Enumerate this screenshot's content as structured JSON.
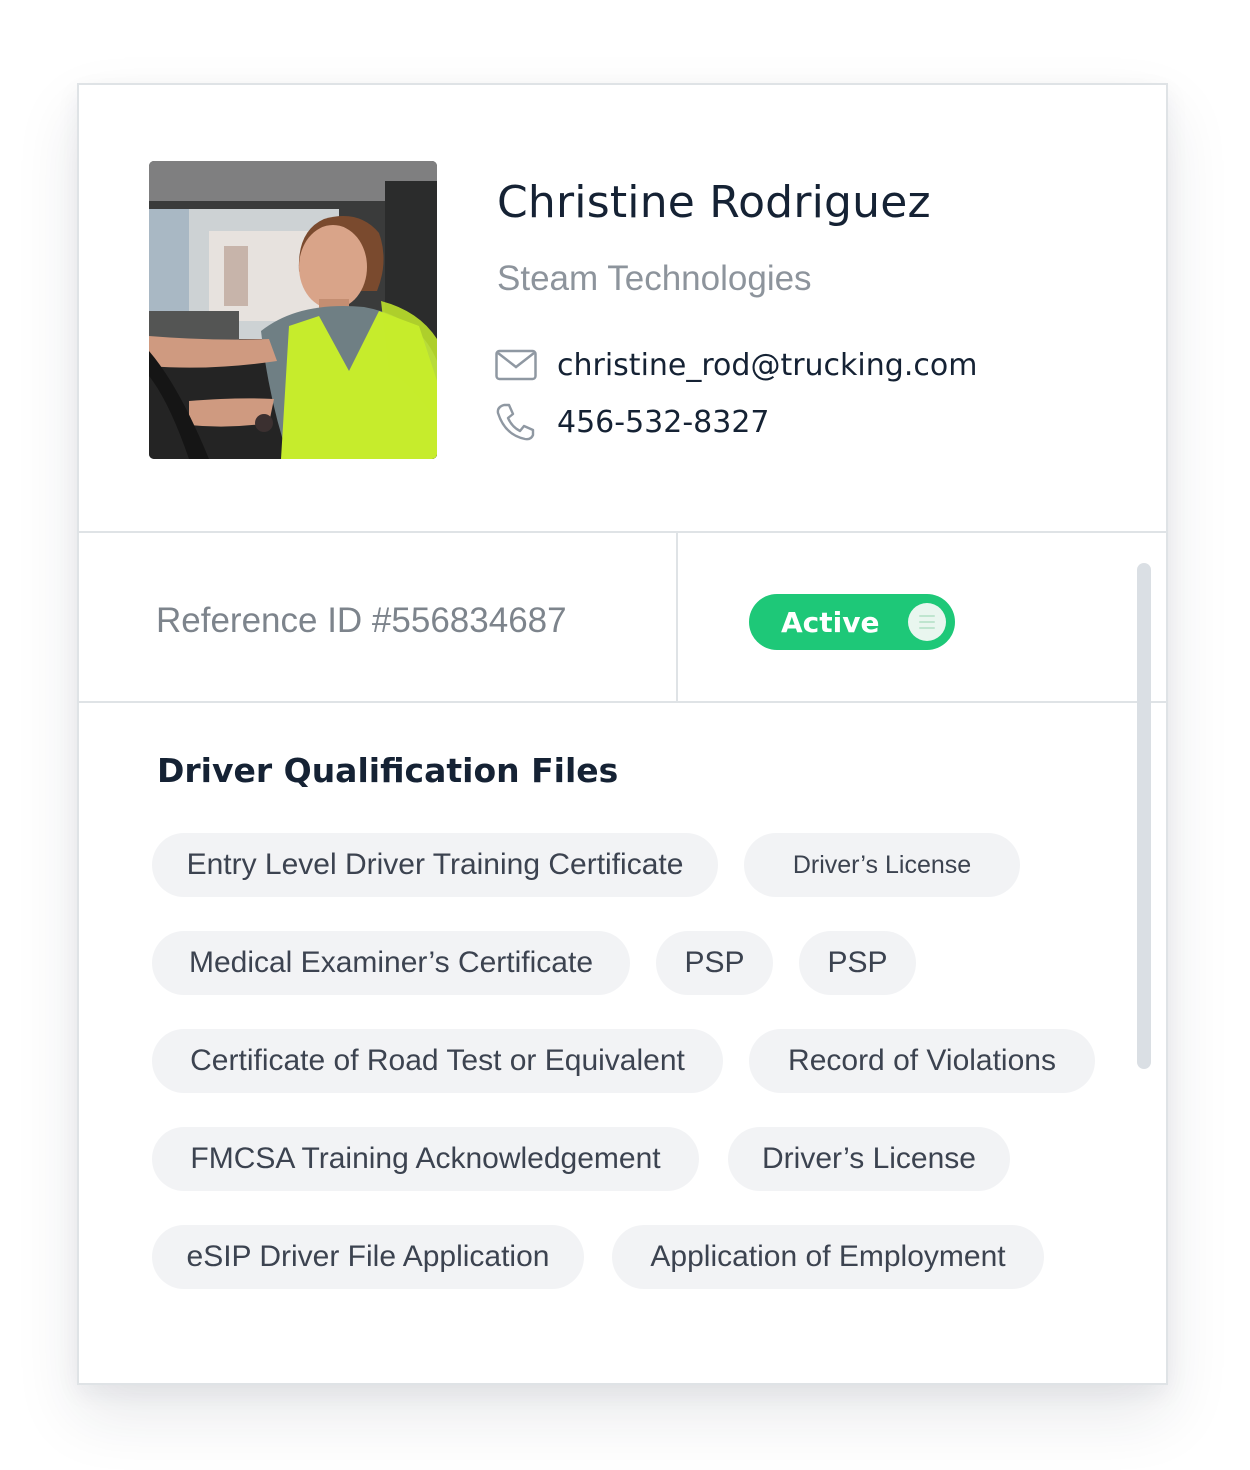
{
  "profile": {
    "name": "Christine Rodriguez",
    "company": "Steam Technologies",
    "email": "christine_rod@trucking.com",
    "phone": "456-532-8327",
    "photo_alt": "Driver photo",
    "email_icon": "envelope-icon",
    "phone_icon": "phone-icon"
  },
  "reference": {
    "text": "Reference ID #556834687"
  },
  "status": {
    "label": "Active",
    "color": "#1ec878"
  },
  "files": {
    "title": "Driver Qualification Files",
    "rows": [
      [
        "Entry Level Driver Training Certificate",
        "Driver’s License"
      ],
      [
        "Medical Examiner’s Certificate",
        "PSP",
        "PSP"
      ],
      [
        "Certificate of Road Test or Equivalent",
        "Record of Violations"
      ],
      [
        "FMCSA Training Acknowledgement",
        "Driver’s License"
      ],
      [
        "eSIP Driver File Application",
        "Application of Employment"
      ]
    ]
  },
  "colors": {
    "accent": "#1ec878",
    "text_dark": "#152234",
    "text_muted": "#8d949c",
    "chip_bg": "#f2f3f5",
    "divider": "#dfe3e6"
  }
}
